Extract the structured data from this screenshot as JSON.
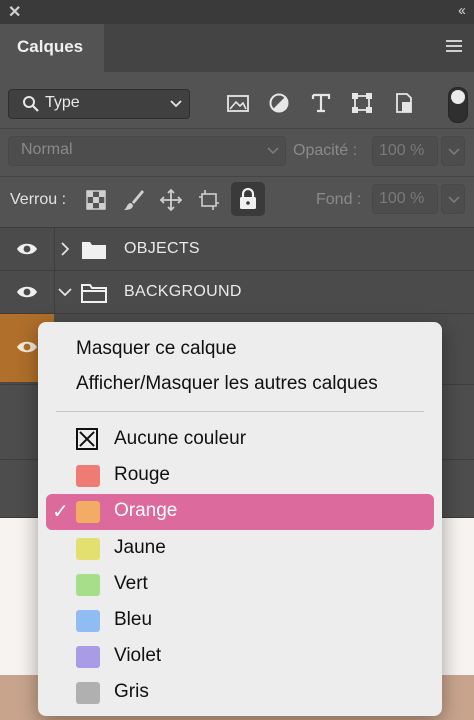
{
  "panel": {
    "title": "Calques",
    "filter": {
      "kind_label": "Type"
    },
    "blend_mode": "Normal",
    "opacity": {
      "label": "Opacité :",
      "value": "100 %"
    },
    "lock": {
      "label": "Verrou :"
    },
    "fill": {
      "label": "Fond :",
      "value": "100 %"
    }
  },
  "layers": [
    {
      "name": "OBJECTS",
      "expanded": false
    },
    {
      "name": "BACKGROUND",
      "expanded": true
    }
  ],
  "context_menu": {
    "actions": [
      "Masquer ce calque",
      "Afficher/Masquer les autres calques"
    ],
    "colors": [
      {
        "label": "Aucune couleur",
        "color": null,
        "selected": false
      },
      {
        "label": "Rouge",
        "color": "#ee7b74",
        "selected": false
      },
      {
        "label": "Orange",
        "color": "#f3ac64",
        "selected": true
      },
      {
        "label": "Jaune",
        "color": "#e3e06f",
        "selected": false
      },
      {
        "label": "Vert",
        "color": "#a6de8a",
        "selected": false
      },
      {
        "label": "Bleu",
        "color": "#8ebcf3",
        "selected": false
      },
      {
        "label": "Violet",
        "color": "#a99be6",
        "selected": false
      },
      {
        "label": "Gris",
        "color": "#b0b0b0",
        "selected": false
      }
    ],
    "highlight_color": "#dd6a9c"
  },
  "icons": [
    "close-icon",
    "collapse-icon",
    "panel-menu-icon",
    "search-icon",
    "chevron-down-icon",
    "image-filter-icon",
    "adjustment-filter-icon",
    "text-filter-icon",
    "shape-filter-icon",
    "smart-object-filter-icon",
    "lock-transparency-icon",
    "lock-brush-icon",
    "lock-move-icon",
    "lock-artboard-icon",
    "lock-all-icon",
    "eye-icon",
    "folder-icon",
    "checkmark-icon"
  ]
}
